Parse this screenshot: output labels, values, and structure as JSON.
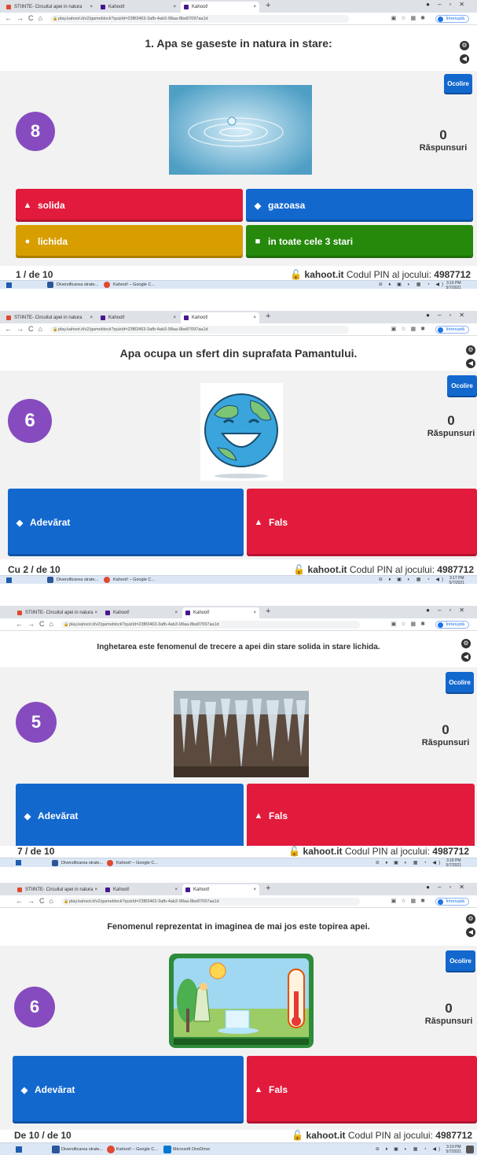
{
  "browser": {
    "tabs": [
      "STIINTE- Circuitul apei in natura",
      "Kahoot!",
      "Kahoot!"
    ],
    "url": "play.kahoot.it/v2/gameblock?quizId=23f83463-3afb-4ab3-98aa-8be87097aa1d",
    "profile_label": "Întreruptă",
    "close_glyph": "×",
    "new_tab_glyph": "+"
  },
  "taskbar": {
    "items": [
      "Diversificarea strate...",
      "Kahoot! – Google C...",
      "Microsoft OneDrive"
    ],
    "date": "5/7/2021"
  },
  "game": {
    "skip_label": "Ocolire",
    "answers_label": "Răspunsuri",
    "answers_count": "0",
    "pin_site": "kahoot.it",
    "pin_text": "Codul PIN al jocului:",
    "pin": "4987712"
  },
  "screens": [
    {
      "time": "3:16 PM",
      "question": "1. Apa se gaseste in natura in stare:",
      "timer": "8",
      "progress": "1 / de 10",
      "image": "water-drop",
      "answers": [
        {
          "shape": "▲",
          "label": "solida",
          "color": "#e21b3c"
        },
        {
          "shape": "◆",
          "label": "gazoasa",
          "color": "#1368ce"
        },
        {
          "shape": "●",
          "label": "lichida",
          "color": "#d89e00"
        },
        {
          "shape": "■",
          "label": "in toate cele 3 stari",
          "color": "#26890c"
        }
      ]
    },
    {
      "time": "3:17 PM",
      "question": "Apa ocupa un sfert din suprafata Pamantului.",
      "timer": "6",
      "progress": "Cu 2 / de 10",
      "image": "smiling-earth",
      "answers": [
        {
          "shape": "◆",
          "label": "Adevărat",
          "color": "#1368ce"
        },
        {
          "shape": "▲",
          "label": "Fals",
          "color": "#e21b3c"
        }
      ]
    },
    {
      "time": "3:18 PM",
      "question": "Inghetarea este fenomenul de trecere a apei din stare solida in stare lichida.",
      "timer": "5",
      "progress": "7 / de 10",
      "image": "icicles",
      "answers": [
        {
          "shape": "◆",
          "label": "Adevărat",
          "color": "#1368ce"
        },
        {
          "shape": "▲",
          "label": "Fals",
          "color": "#e21b3c"
        }
      ]
    },
    {
      "time": "3:19 PM",
      "question": "Fenomenul reprezentat in imaginea de mai jos este topirea apei.",
      "timer": "6",
      "progress": "De 10 / de 10",
      "image": "melting-ice-cartoon",
      "answers": [
        {
          "shape": "◆",
          "label": "Adevărat",
          "color": "#1368ce"
        },
        {
          "shape": "▲",
          "label": "Fals",
          "color": "#e21b3c"
        }
      ]
    }
  ]
}
